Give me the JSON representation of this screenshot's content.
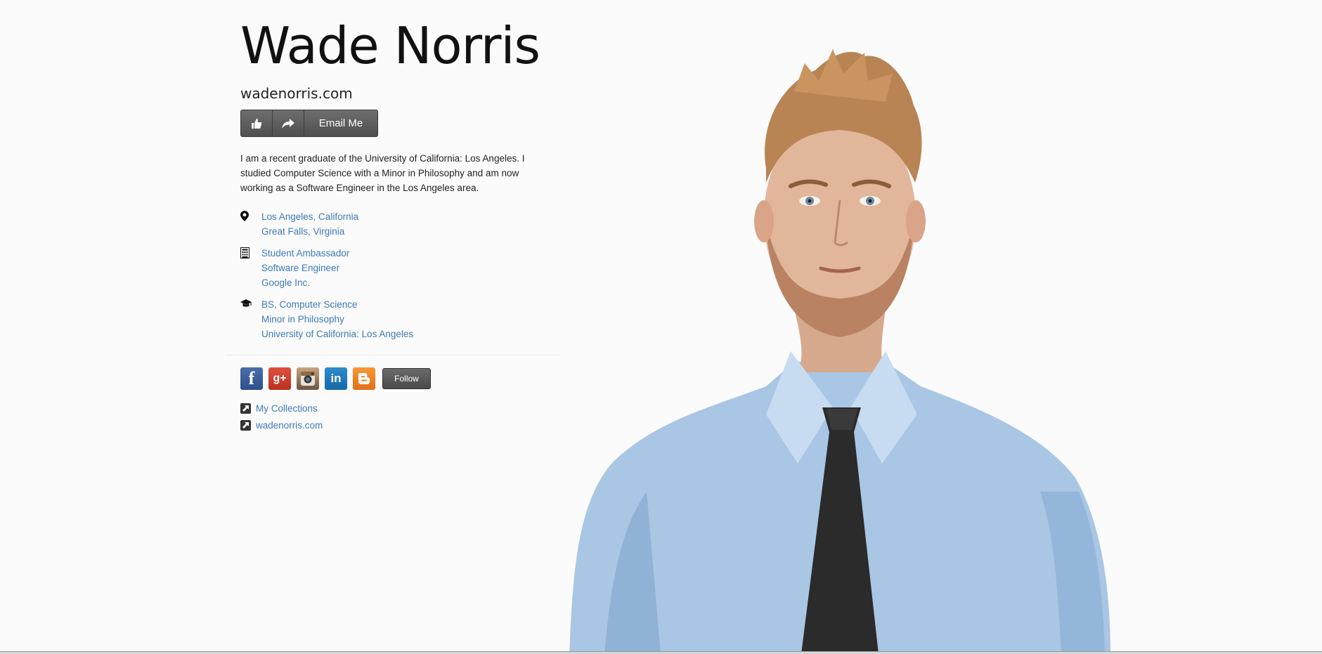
{
  "profile": {
    "name": "Wade Norris",
    "website": "wadenorris.com",
    "email_button": "Email Me",
    "bio": "I am a recent graduate of the University of California: Los Angeles. I studied Computer Science with a Minor in Philosophy and am now working as a Software Engineer in the Los Angeles area."
  },
  "location": {
    "icon": "map-pin-icon",
    "lines": [
      "Los Angeles, California",
      "Great Falls, Virginia"
    ]
  },
  "work": {
    "icon": "building-icon",
    "lines": [
      "Student Ambassador",
      "Software Engineer",
      "Google Inc."
    ]
  },
  "education": {
    "icon": "graduation-cap-icon",
    "lines": [
      "BS, Computer Science",
      "Minor in Philosophy",
      "University of California: Los Angeles"
    ]
  },
  "social": {
    "icons": [
      "facebook-icon",
      "google-plus-icon",
      "instagram-icon",
      "linkedin-icon",
      "blogger-icon"
    ],
    "follow_label": "Follow"
  },
  "links": [
    "My Collections",
    "wadenorris.com"
  ],
  "colors": {
    "link": "#3d7ab5",
    "button": "#555555",
    "background": "#fbfbfb"
  }
}
